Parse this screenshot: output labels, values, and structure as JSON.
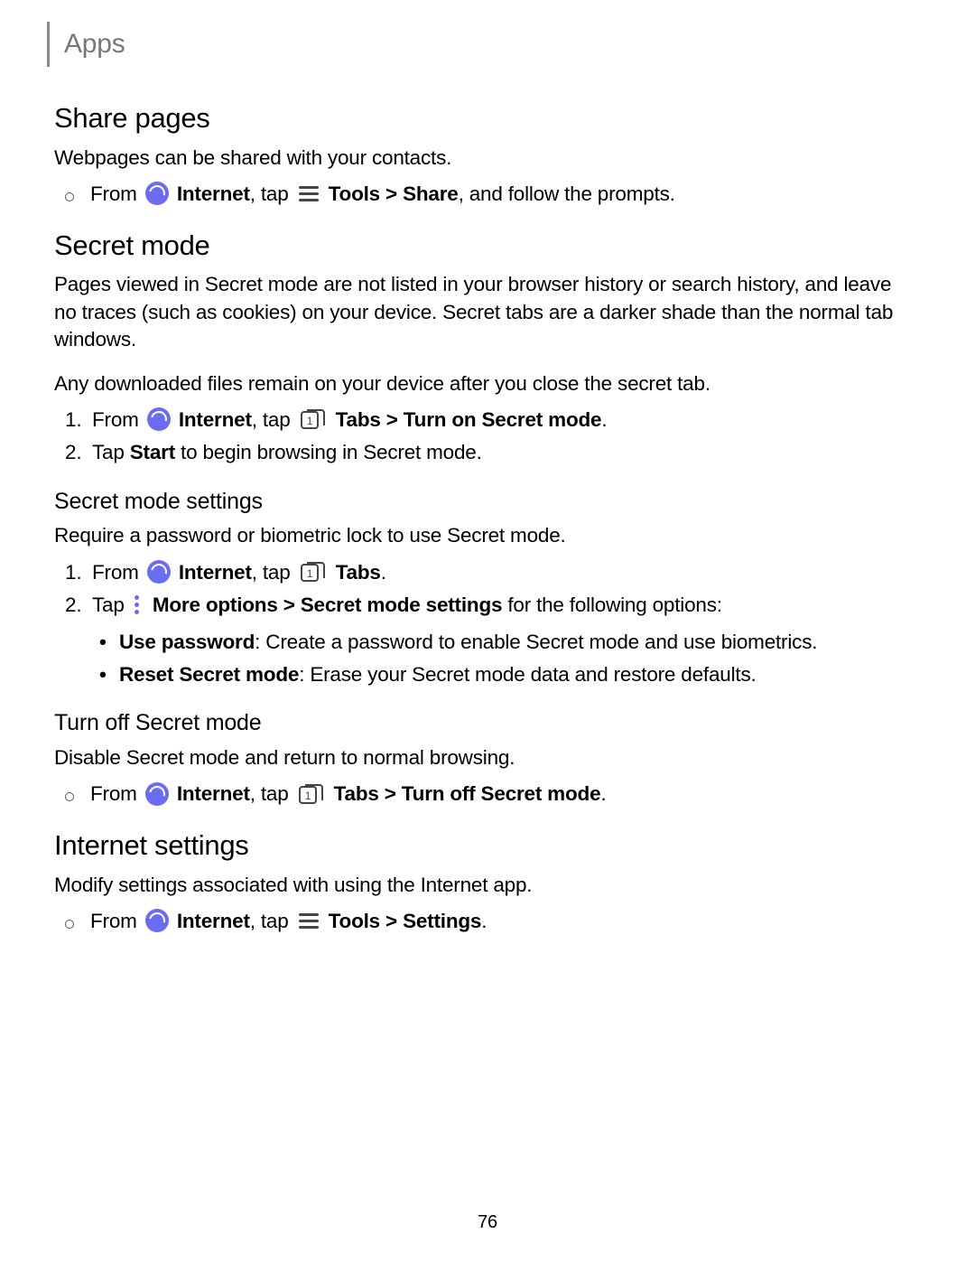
{
  "header": {
    "section": "Apps"
  },
  "page_number": "76",
  "s1": {
    "title": "Share pages",
    "intro": "Webpages can be shared with your contacts.",
    "step": {
      "pre": "From",
      "internet": "Internet",
      "tap": ", tap",
      "tools": "Tools",
      "gt1": ">",
      "share": "Share",
      "post": ", and follow the prompts."
    }
  },
  "s2": {
    "title": "Secret mode",
    "intro": "Pages viewed in Secret mode are not listed in your browser history or search history, and leave no traces (such as cookies) on your device. Secret tabs are a darker shade than the normal tab windows.",
    "intro2": "Any downloaded files remain on your device after you close the secret tab.",
    "step1": {
      "num": "1.",
      "pre": "From",
      "internet": "Internet",
      "tap": ", tap",
      "tabs": "Tabs",
      "gt1": ">",
      "action": "Turn on Secret mode",
      "dot": "."
    },
    "step2": {
      "num": "2.",
      "text_a": "Tap ",
      "text_b": "Start",
      "text_c": " to begin browsing in Secret mode."
    }
  },
  "s3": {
    "title": "Secret mode settings",
    "intro": "Require a password or biometric lock to use Secret mode.",
    "step1": {
      "num": "1.",
      "pre": "From",
      "internet": "Internet",
      "tap": ", tap",
      "tabs": "Tabs",
      "dot": "."
    },
    "step2": {
      "num": "2.",
      "pre": "Tap",
      "more": "More options",
      "gt1": ">",
      "sms": "Secret mode settings",
      "post": " for the following options:"
    },
    "opt1": {
      "title": "Use password",
      "colon": ": ",
      "text": "Create a password to enable Secret mode and use biometrics."
    },
    "opt2": {
      "title": "Reset Secret mode",
      "colon": ": ",
      "text": "Erase your Secret mode data and restore defaults."
    }
  },
  "s4": {
    "title": "Turn off Secret mode",
    "intro": "Disable Secret mode and return to normal browsing.",
    "step": {
      "pre": "From",
      "internet": "Internet",
      "tap": ", tap",
      "tabs": "Tabs",
      "gt1": ">",
      "action": "Turn off Secret mode",
      "dot": "."
    }
  },
  "s5": {
    "title": "Internet settings",
    "intro": "Modify settings associated with using the Internet app.",
    "step": {
      "pre": "From",
      "internet": "Internet",
      "tap": ", tap",
      "tools": "Tools",
      "gt1": ">",
      "action": "Settings",
      "dot": "."
    }
  }
}
